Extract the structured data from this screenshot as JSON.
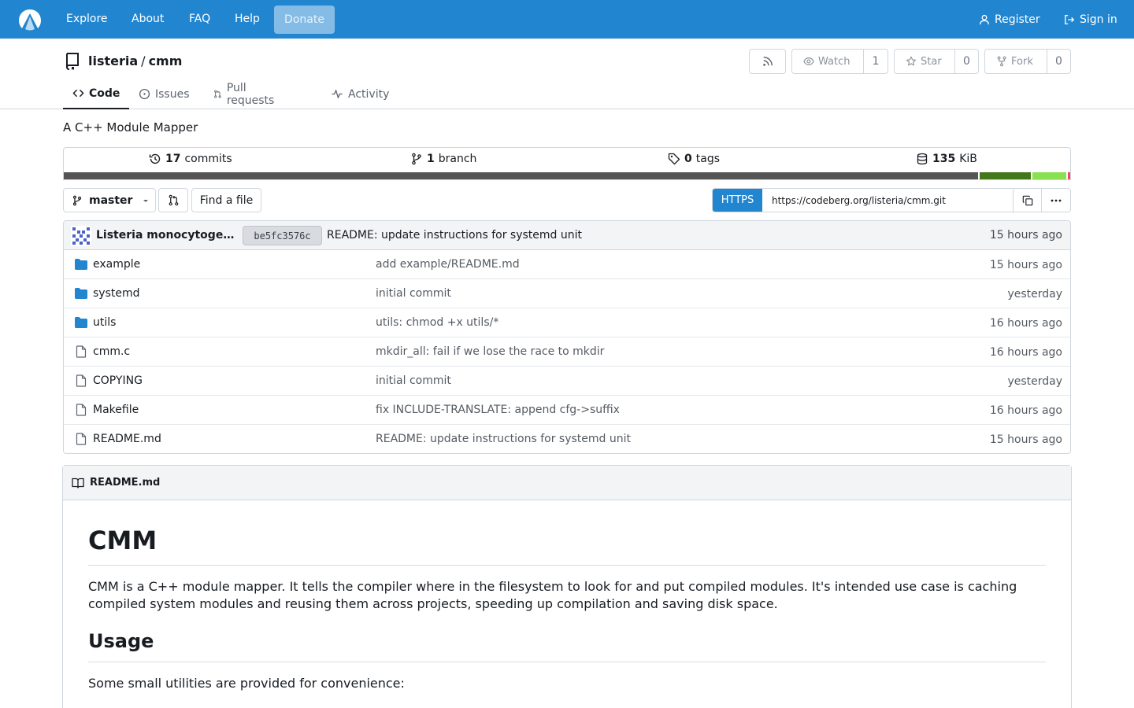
{
  "nav": {
    "logo": "codeberg-logo",
    "links": [
      "Explore",
      "About",
      "FAQ",
      "Help"
    ],
    "donate": "Donate",
    "register": "Register",
    "signin": "Sign in"
  },
  "repo": {
    "owner": "listeria",
    "separator": "/",
    "name": "cmm",
    "watch_label": "Watch",
    "watch_count": "1",
    "star_label": "Star",
    "star_count": "0",
    "fork_label": "Fork",
    "fork_count": "0",
    "tabs": [
      {
        "label": "Code",
        "icon": "code-icon",
        "active": true
      },
      {
        "label": "Issues",
        "icon": "issue-icon"
      },
      {
        "label": "Pull requests",
        "icon": "pull-request-icon"
      },
      {
        "label": "Activity",
        "icon": "pulse-icon"
      }
    ],
    "description": "A C++ Module Mapper"
  },
  "stats": {
    "commits_num": "17",
    "commits_label": "commits",
    "branches_num": "1",
    "branches_label": "branch",
    "tags_num": "0",
    "tags_label": "tags",
    "size_num": "135",
    "size_unit": "KiB",
    "languages": [
      {
        "share": 0.907,
        "color": "#555555"
      },
      {
        "share": 0.052,
        "color": "#427819"
      },
      {
        "share": 0.035,
        "color": "#89e051"
      },
      {
        "share": 0.006,
        "color": "#f1446c"
      }
    ]
  },
  "branch": {
    "name": "master",
    "find_file": "Find a file",
    "clone_protocol": "HTTPS",
    "clone_url": "https://codeberg.org/listeria/cmm.git"
  },
  "latest_commit": {
    "author": "Listeria monocytogenes",
    "sha": "be5fc3576c",
    "message": "README: update instructions for systemd unit",
    "time": "15 hours ago"
  },
  "files": [
    {
      "type": "dir",
      "name": "example",
      "message": "add example/README.md",
      "time": "15 hours ago"
    },
    {
      "type": "dir",
      "name": "systemd",
      "message": "initial commit",
      "time": "yesterday"
    },
    {
      "type": "dir",
      "name": "utils",
      "message": "utils: chmod +x utils/*",
      "time": "16 hours ago"
    },
    {
      "type": "file",
      "name": "cmm.c",
      "message": "mkdir_all: fail if we lose the race to mkdir",
      "time": "16 hours ago"
    },
    {
      "type": "file",
      "name": "COPYING",
      "message": "initial commit",
      "time": "yesterday"
    },
    {
      "type": "file",
      "name": "Makefile",
      "message": "fix INCLUDE-TRANSLATE: append cfg->suffix",
      "time": "16 hours ago"
    },
    {
      "type": "file",
      "name": "README.md",
      "message": "README: update instructions for systemd unit",
      "time": "15 hours ago"
    }
  ],
  "readme": {
    "filename": "README.md",
    "h1": "CMM",
    "intro": "CMM is a C++ module mapper. It tells the compiler where in the filesystem to look for and put compiled modules. It's intended use case is caching compiled system modules and reusing them across projects, speeding up compilation and saving disk space.",
    "h2": "Usage",
    "usage_text": "Some small utilities are provided for convenience:"
  }
}
